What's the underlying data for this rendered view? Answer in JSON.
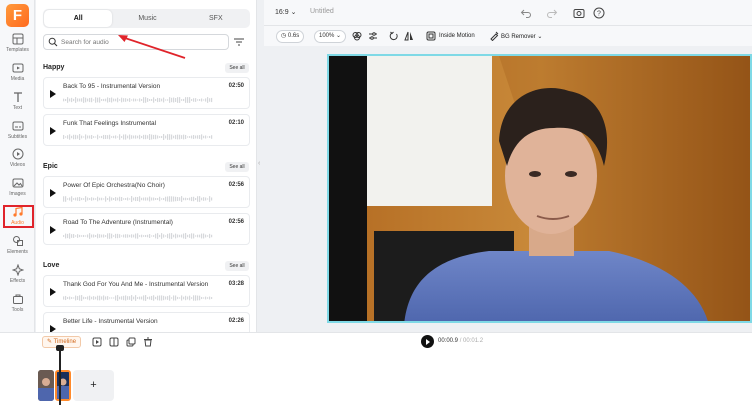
{
  "app": {
    "logo_letter": "F",
    "brand_color": "#ff7a2b"
  },
  "rail": {
    "items": [
      {
        "label": "Templates",
        "icon": "templates-icon"
      },
      {
        "label": "Media",
        "icon": "media-icon"
      },
      {
        "label": "Text",
        "icon": "text-icon"
      },
      {
        "label": "Subtitles",
        "icon": "subtitles-icon"
      },
      {
        "label": "Videos",
        "icon": "videos-icon"
      },
      {
        "label": "Images",
        "icon": "images-icon"
      },
      {
        "label": "Audio",
        "icon": "music-icon",
        "active": true
      },
      {
        "label": "Elements",
        "icon": "elements-icon"
      },
      {
        "label": "Effects",
        "icon": "effects-icon"
      },
      {
        "label": "Tools",
        "icon": "tools-icon"
      }
    ]
  },
  "audio_panel": {
    "tabs": [
      {
        "label": "All",
        "active": true
      },
      {
        "label": "Music"
      },
      {
        "label": "SFX"
      }
    ],
    "search": {
      "placeholder": "Search for audio"
    },
    "sections": [
      {
        "title": "Happy",
        "see_all": "See all",
        "tracks": [
          {
            "title": "Back To 95 - Instrumental Version",
            "duration": "02:50"
          },
          {
            "title": "Funk That Feelings Instrumental",
            "duration": "02:10"
          }
        ]
      },
      {
        "title": "Epic",
        "see_all": "See all",
        "tracks": [
          {
            "title": "Power Of Epic Orchestra(No Choir)",
            "duration": "02:56"
          },
          {
            "title": "Road To The Adventure (Instrumental)",
            "duration": "02:56"
          }
        ]
      },
      {
        "title": "Love",
        "see_all": "See all",
        "tracks": [
          {
            "title": "Thank God For You And Me - Instrumental Version",
            "duration": "03:28"
          },
          {
            "title": "Better Life - Instrumental Version",
            "duration": "02:26"
          }
        ]
      }
    ]
  },
  "topbar": {
    "aspect_ratio": "16:9",
    "project_title": "Untitled"
  },
  "edit_toolbar": {
    "duration": "0.6s",
    "zoom": "100%",
    "inside_motion": "Inside Motion",
    "bg_remover": "BG Remover"
  },
  "timeline": {
    "label": "Timeline",
    "current_time": "00:00.9",
    "total_time": "/ 00:01.2",
    "add_label": "+"
  },
  "colors": {
    "annotation_red": "#e0242b",
    "selection_cyan": "#7fd9e6"
  }
}
